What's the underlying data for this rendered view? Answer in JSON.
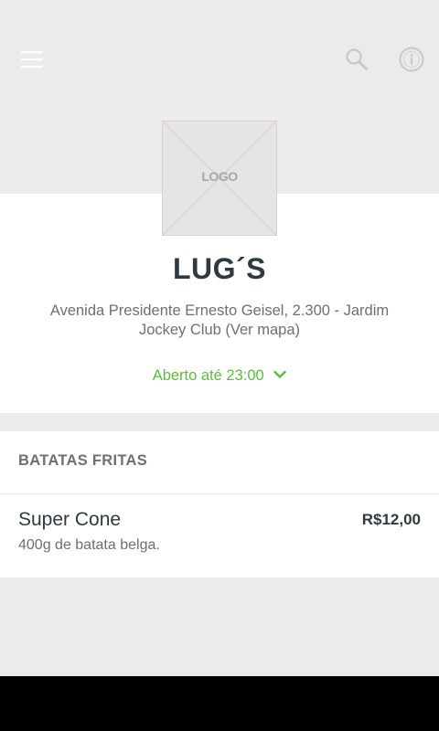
{
  "header": {
    "menu_icon": "hamburger-menu-icon",
    "search_icon": "search-icon",
    "info_icon": "info-icon"
  },
  "store": {
    "logo_placeholder": "LOGO",
    "name": "LUG´S",
    "address": "Avenida Presidente Ernesto Geisel, 2.300 - Jardim Jockey Club (Ver mapa)",
    "status": "Aberto até 23:00"
  },
  "menu": {
    "sections": [
      {
        "title": "BATATAS FRITAS",
        "items": [
          {
            "name": "Super Cone",
            "description": "400g de batata belga.",
            "price": "R$12,00"
          }
        ]
      }
    ]
  },
  "colors": {
    "background": "#ebebeb",
    "card": "#ffffff",
    "accent_green": "#5cbd3a",
    "text_dark": "#2f3a40",
    "text_muted": "#6f6f6f"
  }
}
